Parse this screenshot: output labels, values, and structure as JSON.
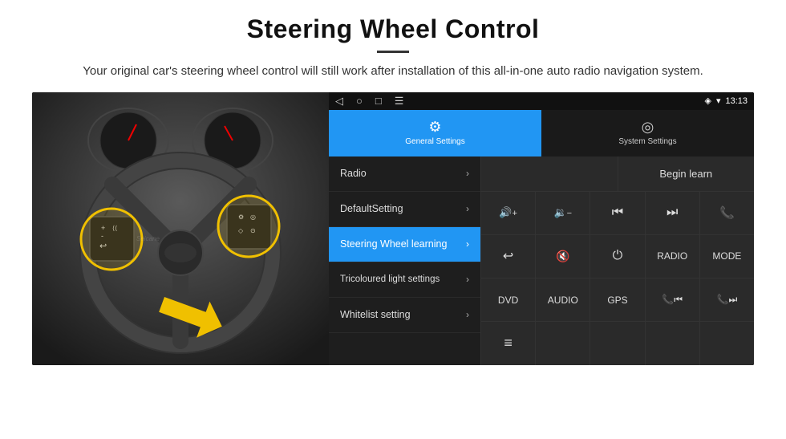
{
  "header": {
    "title": "Steering Wheel Control",
    "subtitle": "Your original car's steering wheel control will still work after installation of this all-in-one auto radio navigation system."
  },
  "status_bar": {
    "nav_icons": [
      "◁",
      "○",
      "□",
      "☰"
    ],
    "signal_icon": "◈",
    "wifi_icon": "▼",
    "time": "13:13"
  },
  "tabs": [
    {
      "id": "general",
      "label": "General Settings",
      "icon": "⚙",
      "active": true
    },
    {
      "id": "system",
      "label": "System Settings",
      "icon": "◎",
      "active": false
    }
  ],
  "menu_items": [
    {
      "id": "radio",
      "label": "Radio",
      "active": false
    },
    {
      "id": "default-setting",
      "label": "DefaultSetting",
      "active": false
    },
    {
      "id": "steering-wheel",
      "label": "Steering Wheel learning",
      "active": true
    },
    {
      "id": "tricoloured",
      "label": "Tricoloured light settings",
      "active": false
    },
    {
      "id": "whitelist",
      "label": "Whitelist setting",
      "active": false
    }
  ],
  "begin_learn_label": "Begin learn",
  "control_rows": [
    [
      {
        "id": "vol-up",
        "label": "🔊+",
        "type": "icon"
      },
      {
        "id": "vol-down",
        "label": "🔉-",
        "type": "icon"
      },
      {
        "id": "prev",
        "label": "⏮",
        "type": "icon"
      },
      {
        "id": "next",
        "label": "⏭",
        "type": "icon"
      },
      {
        "id": "phone",
        "label": "📞",
        "type": "icon"
      }
    ],
    [
      {
        "id": "hang-up",
        "label": "↩",
        "type": "icon"
      },
      {
        "id": "mute",
        "label": "🔇",
        "type": "icon"
      },
      {
        "id": "power",
        "label": "⏻",
        "type": "icon"
      },
      {
        "id": "radio-btn",
        "label": "RADIO",
        "type": "text"
      },
      {
        "id": "mode",
        "label": "MODE",
        "type": "text"
      }
    ],
    [
      {
        "id": "dvd",
        "label": "DVD",
        "type": "text"
      },
      {
        "id": "audio",
        "label": "AUDIO",
        "type": "text"
      },
      {
        "id": "gps",
        "label": "GPS",
        "type": "text"
      },
      {
        "id": "call-prev",
        "label": "📞⏮",
        "type": "icon"
      },
      {
        "id": "call-next",
        "label": "📞⏭",
        "type": "icon"
      }
    ],
    [
      {
        "id": "list-icon",
        "label": "≡",
        "type": "icon"
      },
      {
        "id": "empty2",
        "label": "",
        "type": "empty"
      },
      {
        "id": "empty3",
        "label": "",
        "type": "empty"
      },
      {
        "id": "empty4",
        "label": "",
        "type": "empty"
      },
      {
        "id": "empty5",
        "label": "",
        "type": "empty"
      }
    ]
  ]
}
